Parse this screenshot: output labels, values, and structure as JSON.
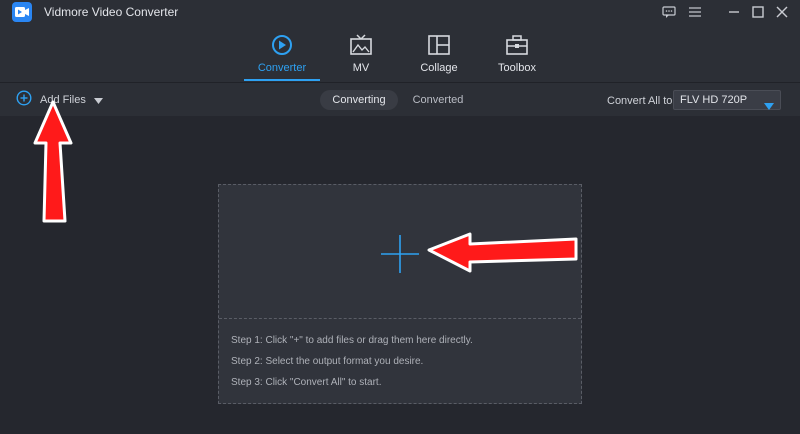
{
  "window": {
    "title": "Vidmore Video Converter",
    "controls": [
      "feedback-icon",
      "menu-icon",
      "minimize-icon",
      "maximize-icon",
      "close-icon"
    ]
  },
  "tabs": [
    {
      "label": "Converter",
      "icon": "converter-icon",
      "active": true
    },
    {
      "label": "MV",
      "icon": "mv-icon",
      "active": false
    },
    {
      "label": "Collage",
      "icon": "collage-icon",
      "active": false
    },
    {
      "label": "Toolbox",
      "icon": "toolbox-icon",
      "active": false
    }
  ],
  "toolbar": {
    "add_files": "Add Files",
    "segments": {
      "converting": "Converting",
      "converted": "Converted"
    },
    "convert_all_label": "Convert All to:",
    "format_value": "FLV HD 720P"
  },
  "dropzone": {
    "steps": [
      "Step 1: Click \"+\" to add files or drag them here directly.",
      "Step 2: Select the output format you desire.",
      "Step 3: Click \"Convert All\" to start."
    ]
  },
  "colors": {
    "accent": "#2ea1f2",
    "annotation_arrow": "#ff1a1a",
    "background": "#25272e"
  }
}
